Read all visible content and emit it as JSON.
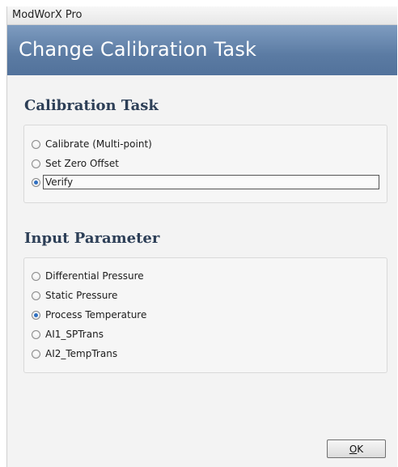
{
  "window": {
    "app_title": "ModWorX Pro",
    "header_title": "Change Calibration Task"
  },
  "calibration_task": {
    "heading": "Calibration Task",
    "options": [
      {
        "label": "Calibrate (Multi-point)",
        "selected": false
      },
      {
        "label": "Set Zero Offset",
        "selected": false
      },
      {
        "label": "Verify",
        "selected": true
      }
    ]
  },
  "input_parameter": {
    "heading": "Input Parameter",
    "options": [
      {
        "label": "Differential Pressure",
        "selected": false
      },
      {
        "label": "Static Pressure",
        "selected": false
      },
      {
        "label": "Process Temperature",
        "selected": true
      },
      {
        "label": "AI1_SPTrans",
        "selected": false
      },
      {
        "label": "AI2_TempTrans",
        "selected": false
      }
    ]
  },
  "footer": {
    "ok_label": "OK",
    "ok_access_key": "O",
    "ok_rest": "K"
  },
  "colors": {
    "banner": "#5b7ba3",
    "heading": "#2d3f57",
    "radio_dot": "#2f6fc1"
  }
}
